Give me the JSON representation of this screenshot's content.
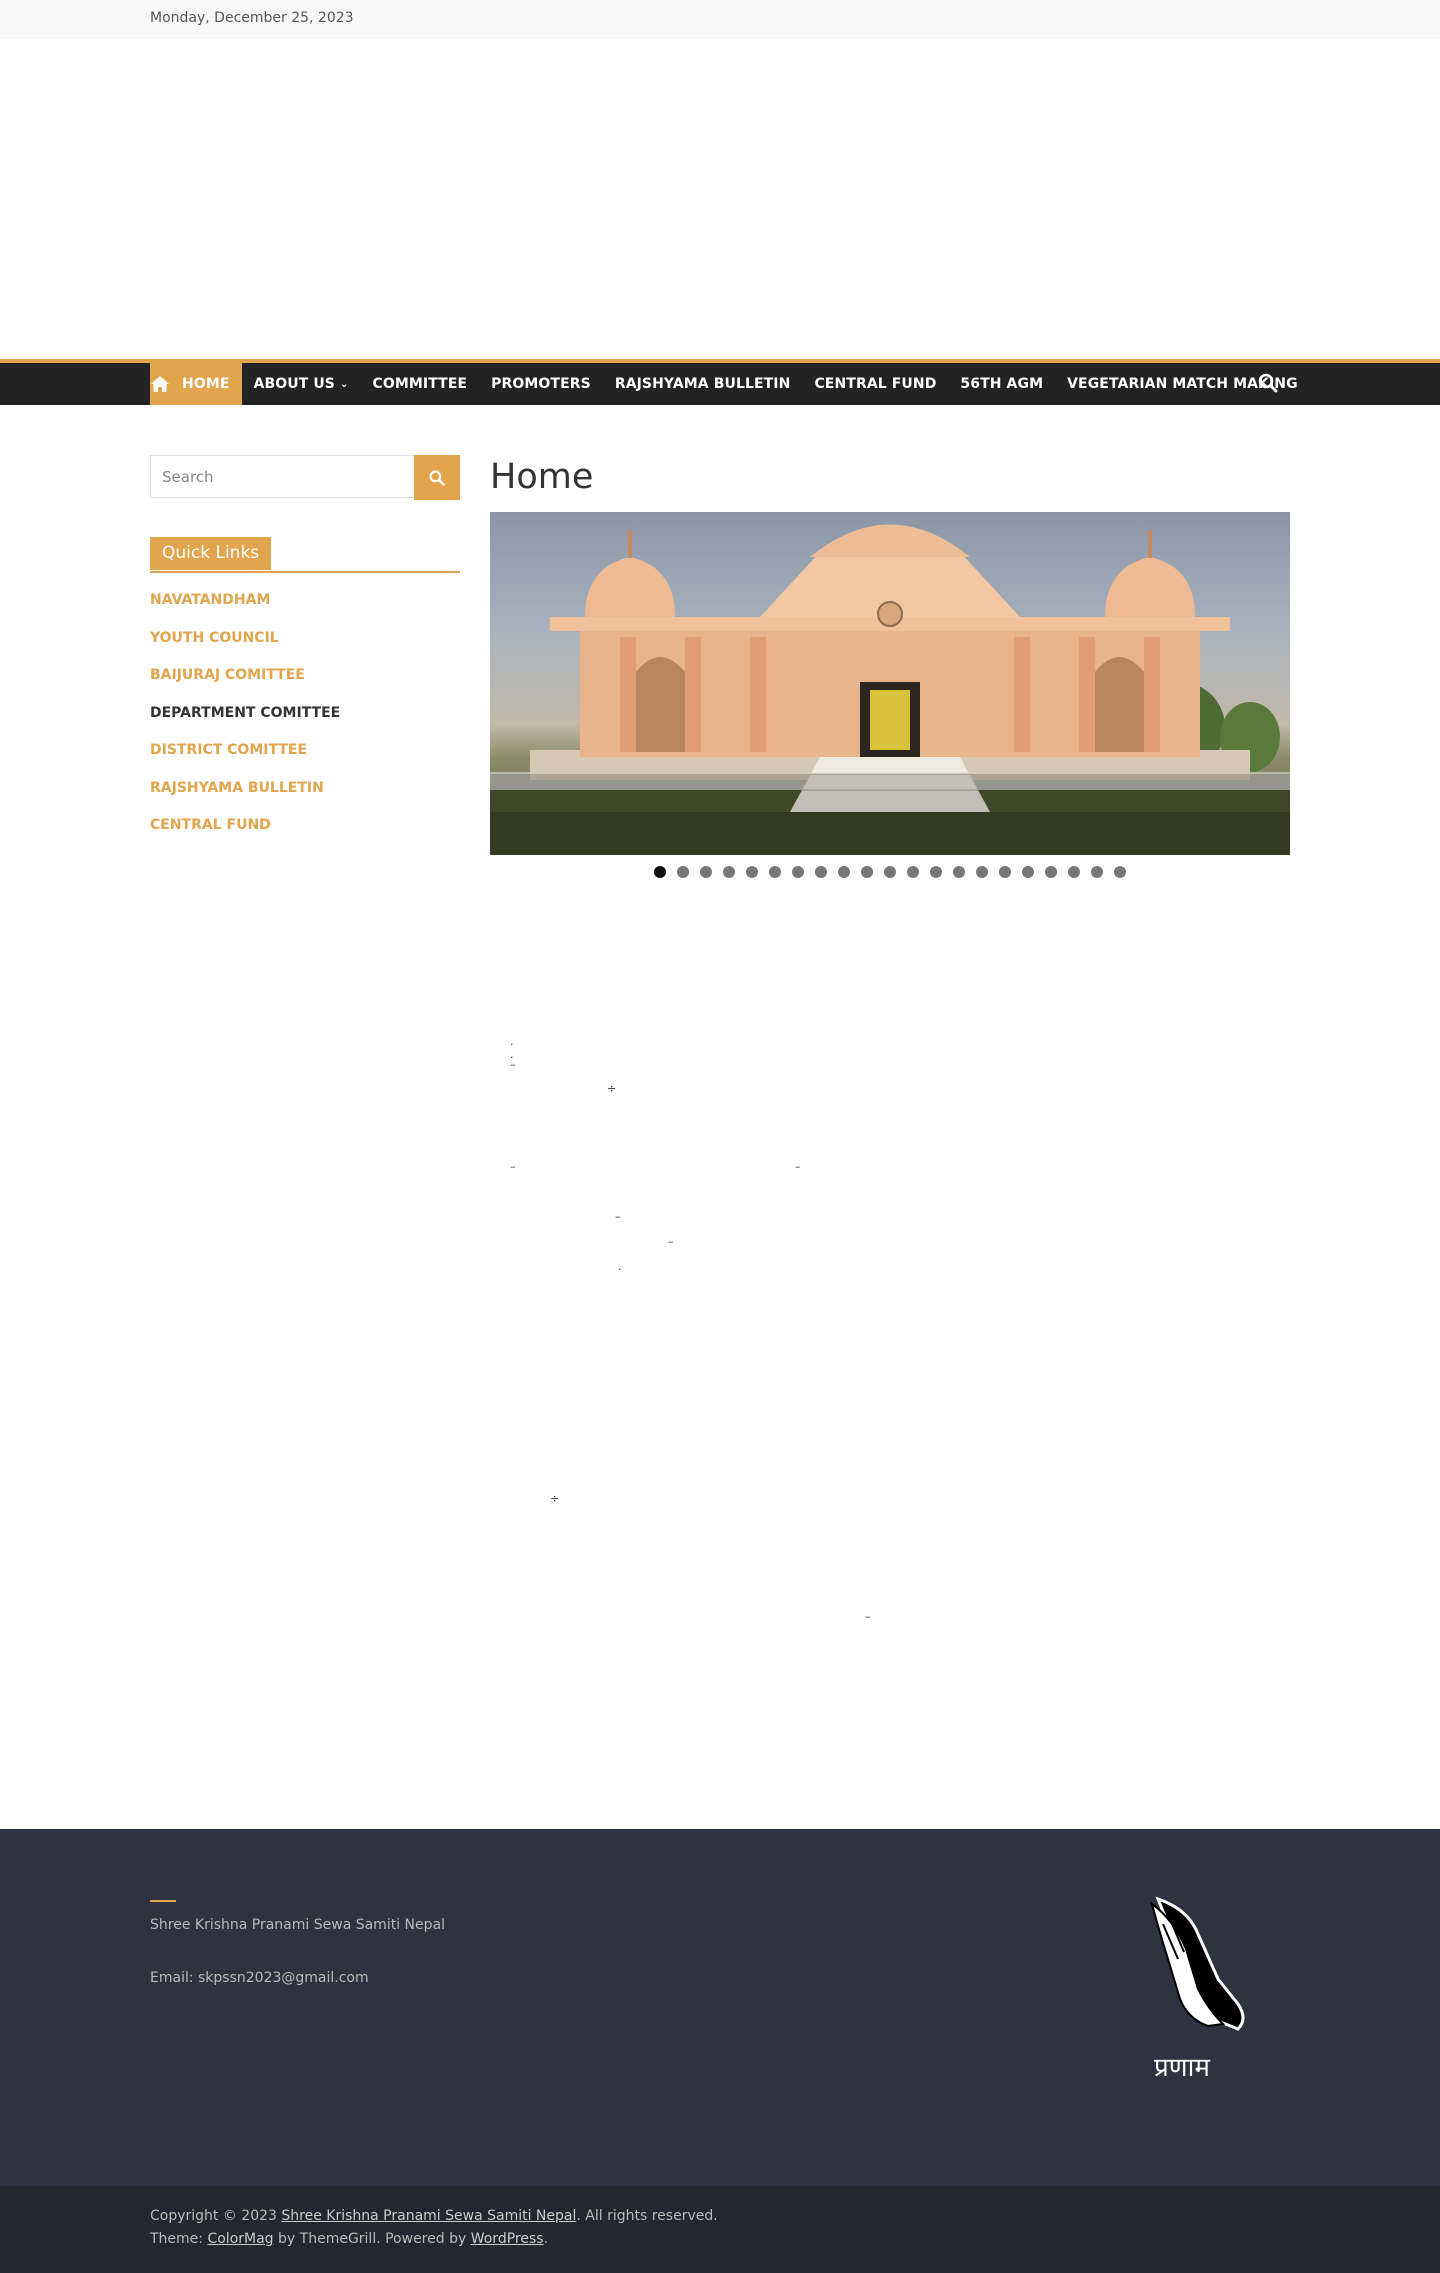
{
  "topbar": {
    "date": "Monday, December 25, 2023"
  },
  "nav": {
    "items": [
      {
        "label": "HOME"
      },
      {
        "label": "ABOUT US"
      },
      {
        "label": "COMMITTEE"
      },
      {
        "label": "PROMOTERS"
      },
      {
        "label": "RAJSHYAMA BULLETIN"
      },
      {
        "label": "CENTRAL FUND"
      },
      {
        "label": "56TH AGM"
      },
      {
        "label": "VEGETARIAN MATCH MAKING"
      }
    ],
    "home_icon": "home-icon",
    "search_icon": "search-icon"
  },
  "sidebar": {
    "search": {
      "placeholder": "Search"
    },
    "quick_links_title": "Quick Links",
    "quick_links": [
      "NAVATANDHAM",
      "YOUTH COUNCIL",
      "BAIJURAJ COMITTEE",
      "DEPARTMENT COMITTEE",
      "DISTRICT COMITTEE",
      "RAJSHYAMA BULLETIN",
      "CENTRAL FUND"
    ]
  },
  "main": {
    "title": "Home",
    "slider": {
      "slide_count": 21,
      "active_index": 0
    }
  },
  "footer": {
    "org_name": "Shree Krishna Pranami Sewa Samiti Nepal",
    "email": "Email: skpssn2023@gmail.com",
    "pranam": "प्रणाम",
    "copyright_prefix": "Copyright © 2023 ",
    "copyright_link": "Shree Krishna Pranami Sewa Samiti Nepal",
    "copyright_suffix": ". All rights reserved.",
    "theme_prefix": "Theme: ",
    "theme_link": "ColorMag",
    "theme_mid": " by ThemeGrill. Powered by ",
    "wp_link": "WordPress",
    "theme_suffix": "."
  },
  "colors": {
    "accent": "#e2a44c",
    "nav_bg": "#232323",
    "footer_bg": "#2f3240",
    "footer_bottom_bg": "#252730"
  }
}
